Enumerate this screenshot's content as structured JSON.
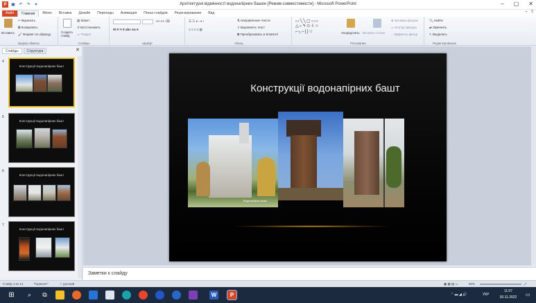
{
  "window": {
    "title": "Архітектурні відмінності водонапірних башен [Режим совместимости] - Microsoft PowerPoint",
    "app_logo": "P",
    "controls": [
      "–",
      "▢",
      "✕"
    ],
    "help": [
      "⌃",
      "?"
    ]
  },
  "ribbon_tabs": [
    "Файл",
    "Главная",
    "Меню",
    "Вставка",
    "Дизайн",
    "Переходы",
    "Анимация",
    "Показ слайдов",
    "Рецензирование",
    "Вид"
  ],
  "ribbon": {
    "clipboard": {
      "paste": "Вставить",
      "cut": "Вырезать",
      "copy": "Копировать",
      "format_painter": "Формат по образцу",
      "group": "Буфер обмена"
    },
    "slides": {
      "new_slide": "Создать слайд",
      "layout": "Макет",
      "reset": "Восстановить",
      "section": "Раздел",
      "group": "Слайды"
    },
    "font": {
      "group": "Шрифт"
    },
    "paragraph": {
      "text_direction": "Направление текста",
      "align_text": "Выровнять текст",
      "smartart": "Преобразовать в SmartArt",
      "group": "Абзац"
    },
    "drawing": {
      "arrange": "Упорядочить",
      "quick_styles": "Экспресс-стили",
      "shape_fill": "Заливка фигуры",
      "shape_outline": "Контур фигуры",
      "shape_effects": "Эффекты фигур",
      "group": "Рисование"
    },
    "editing": {
      "find": "Найти",
      "replace": "Заменить",
      "select": "Выделить",
      "group": "Редактирование"
    }
  },
  "left_panel": {
    "tabs": [
      "Слайды",
      "Структура"
    ],
    "close": "✕",
    "thumbnails": [
      {
        "num": "4",
        "title": "Конструкції водонапірних башт"
      },
      {
        "num": "5",
        "title": "Конструкції водонапірних башт"
      },
      {
        "num": "6",
        "title": "Конструкції водонапірних башт"
      },
      {
        "num": "7",
        "title": "Конструкції водонапірних башт"
      }
    ]
  },
  "slide": {
    "title": "Конструкції водонапірних башт",
    "caption": "Водонапірна вежа"
  },
  "notes": {
    "placeholder": "Заметки к слайду"
  },
  "status": {
    "slide": "Слайд 4 из 14",
    "theme": "\"Горизонт\"",
    "language": "русский",
    "zoom": "60%"
  },
  "taskbar": {
    "lang": "УКР",
    "time": "11:07",
    "date": "30.11.2022"
  }
}
